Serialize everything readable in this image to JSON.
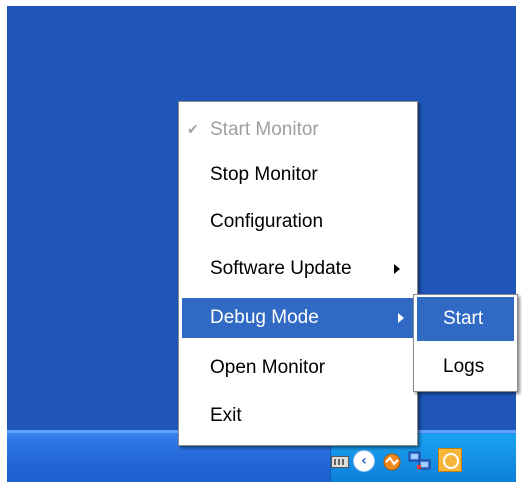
{
  "menu": {
    "items": [
      {
        "label": "Start Monitor",
        "check_glyph": "✔"
      },
      {
        "label": "Stop Monitor"
      },
      {
        "label": "Configuration"
      },
      {
        "label": "Software Update"
      },
      {
        "label": "Debug Mode"
      },
      {
        "label": "Open Monitor"
      },
      {
        "label": "Exit"
      }
    ]
  },
  "submenu": {
    "items": [
      {
        "label": "Start"
      },
      {
        "label": "Logs"
      }
    ]
  },
  "tray": {
    "chevron_glyph": "‹",
    "icons": [
      "keyboard-icon",
      "show-hidden-icons-button",
      "monitor-app-icon",
      "network-icon",
      "clock-app-icon"
    ]
  },
  "colors": {
    "desktop": "#1f56b8",
    "menu_highlight": "#316ac5",
    "disabled_text": "#a0a0a0"
  }
}
